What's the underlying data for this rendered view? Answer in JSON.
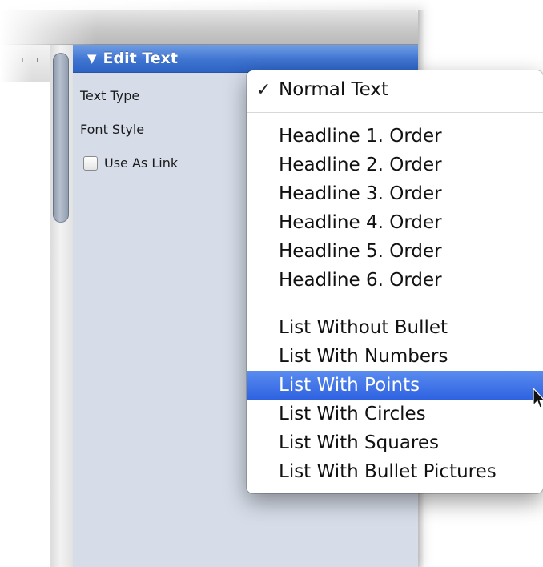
{
  "inspector": {
    "section_title": "Edit Text",
    "section_toggle_icon": "disclosure-triangle-down-icon",
    "text_type_label": "Text Type",
    "font_style_label": "Font Style",
    "use_as_link_label": "Use As Link",
    "use_as_link_checked": false
  },
  "menu": {
    "checked_item": "Normal Text",
    "checkmark_icon": "checkmark-icon",
    "groups": [
      [
        "Normal Text"
      ],
      [
        "Headline 1. Order",
        "Headline 2. Order",
        "Headline 3. Order",
        "Headline 4. Order",
        "Headline 5. Order",
        "Headline 6. Order"
      ],
      [
        "List Without Bullet",
        "List With Numbers",
        "List With Points",
        "List With Circles",
        "List With Squares",
        "List With Bullet Pictures"
      ]
    ],
    "items": {
      "normal_text": "Normal Text",
      "headline_1": "Headline 1. Order",
      "headline_2": "Headline 2. Order",
      "headline_3": "Headline 3. Order",
      "headline_4": "Headline 4. Order",
      "headline_5": "Headline 5. Order",
      "headline_6": "Headline 6. Order",
      "list_without_bullet": "List Without Bullet",
      "list_with_numbers": "List With Numbers",
      "list_with_points": "List With Points",
      "list_with_circles": "List With Circles",
      "list_with_squares": "List With Squares",
      "list_with_bullet_pictures": "List With Bullet Pictures"
    },
    "highlighted_item": "List With Points",
    "highlight_color": "#3a6fe6"
  },
  "colors": {
    "inspector_bg": "#d6dde9",
    "header_blue": "#3f74d1"
  }
}
